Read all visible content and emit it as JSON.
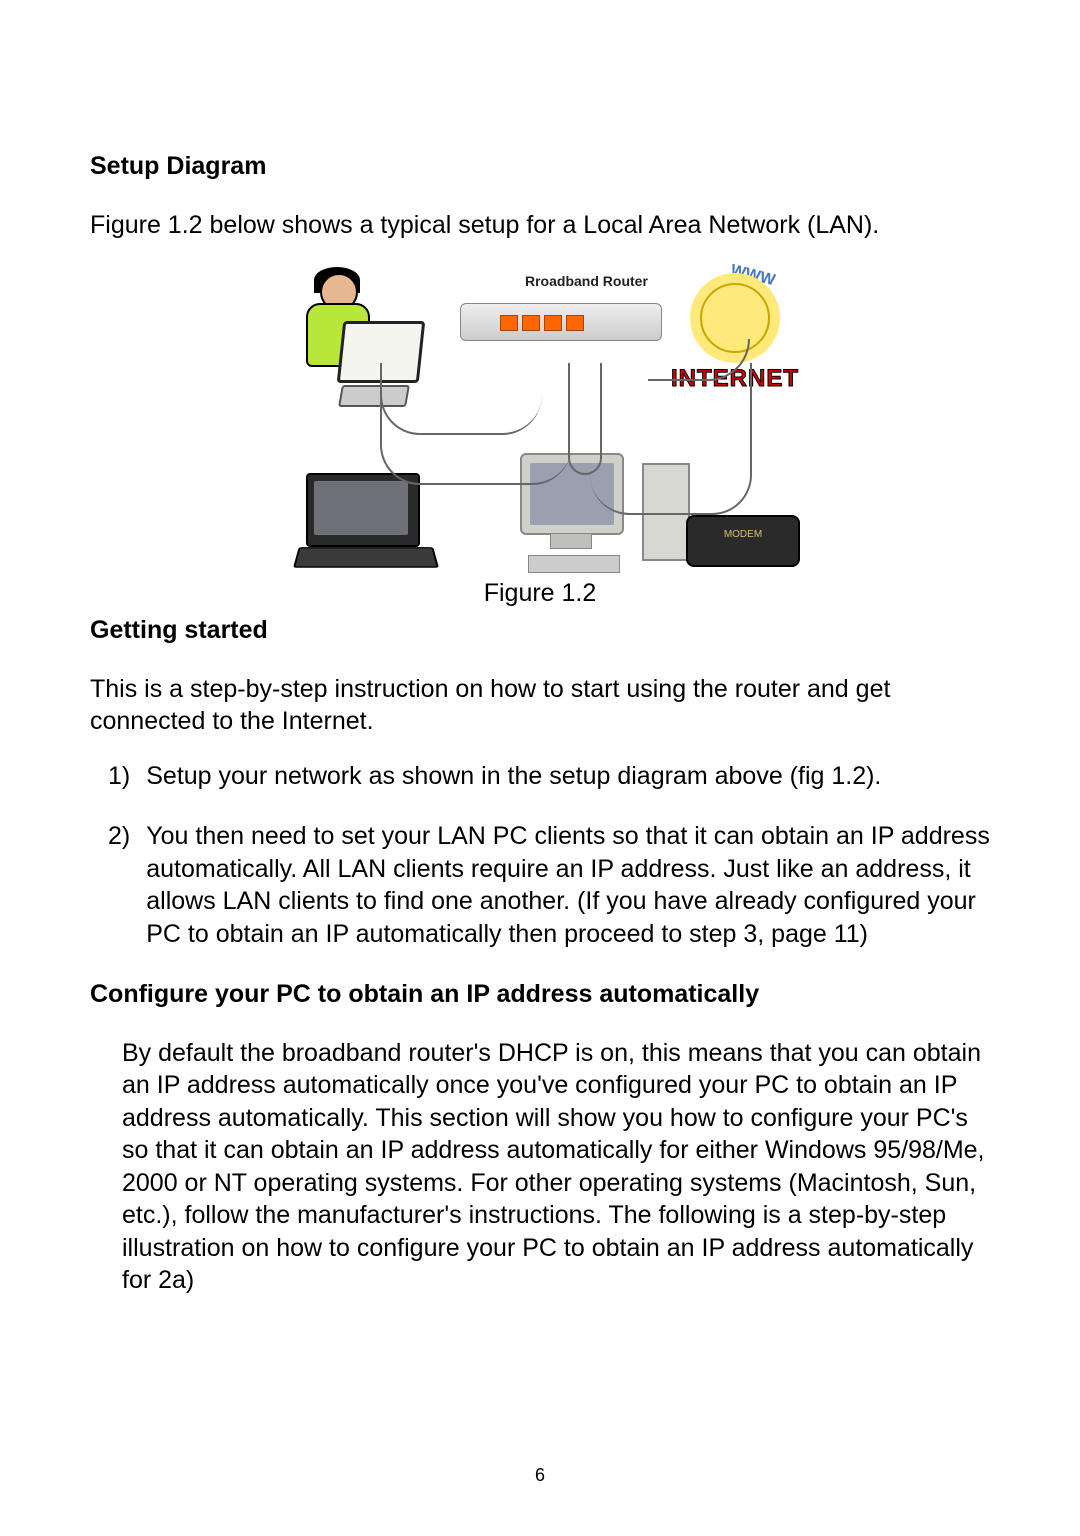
{
  "headings": {
    "setup": "Setup Diagram",
    "getting_started": "Getting started",
    "config_pc": "Configure your PC to obtain an IP address automatically"
  },
  "paragraphs": {
    "setup_desc": "Figure 1.2 below shows a typical setup for a Local Area Network (LAN).",
    "fig_caption": "Figure 1.2",
    "gs_desc": "This is a step-by-step instruction on how to start using the router and get connected to the Internet.",
    "config_body": "By default the broadband router's DHCP is on, this means that you can obtain an IP address automatically once you've configured your PC to obtain an IP address automatically. This section will show you how to configure your PC's so that it can obtain an IP address automatically for either Windows 95/98/Me, 2000 or NT operating systems. For other operating systems (Macintosh, Sun, etc.), follow the manufacturer's instructions. The following is a step-by-step illustration on how to configure your PC to obtain an IP address automatically for 2a)"
  },
  "list": {
    "n1": "1)",
    "n2": "2)",
    "i1": "Setup your network as shown in the setup diagram above (fig 1.2).",
    "i2": "You then need to set your LAN PC clients so that it can obtain an IP address automatically. All LAN clients require an IP address. Just like an address, it allows LAN clients to find one another. (If you have already configured your PC to obtain an IP automatically then proceed to step 3, page 11)"
  },
  "diagram": {
    "router_label": "Rroadband Router",
    "internet_label": "INTERNET",
    "www": "WWW"
  },
  "page_number": "6"
}
